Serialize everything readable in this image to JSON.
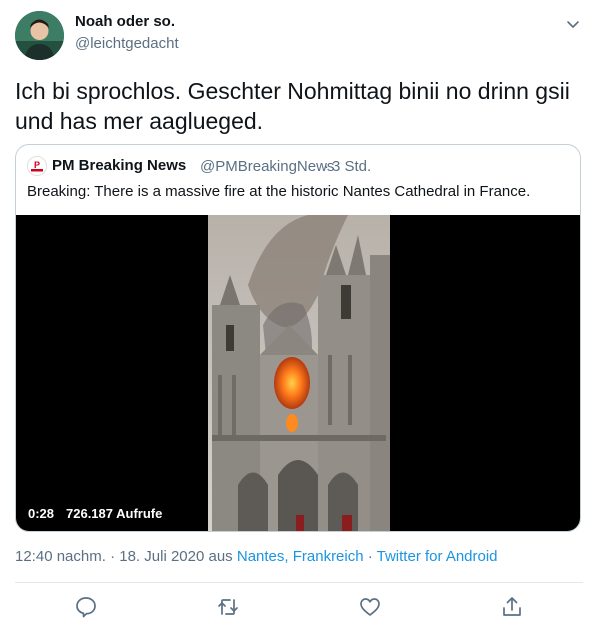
{
  "author": {
    "name": "Noah oder so.",
    "handle": "@leichtgedacht",
    "avatar_icon": "avatar-photo"
  },
  "tweet": {
    "text": "Ich bi sprochlos. Geschter Nohmittag binii no drinn gsii und has mer aaglueged."
  },
  "quoted": {
    "name": "PM Breaking News",
    "handle": "@PMBreakingNews",
    "separator": "·",
    "time": "3 Std.",
    "text": "Breaking: There is a massive fire at the historic Nantes Cathedral in France.",
    "video": {
      "duration": "0:28",
      "views": "726.187 Aufrufe"
    }
  },
  "meta": {
    "time": "12:40 nachm.",
    "sep1": " · ",
    "date": "18. Juli 2020",
    "from_word": " aus ",
    "location": "Nantes, Frankreich",
    "sep2": " · ",
    "source": "Twitter for Android"
  },
  "actions": [
    "reply-icon",
    "retweet-icon",
    "like-icon",
    "share-icon"
  ],
  "colors": {
    "link": "#1b95e0",
    "muted": "#5b7083",
    "text": "#0f1419",
    "border": "#c4cfd6"
  }
}
